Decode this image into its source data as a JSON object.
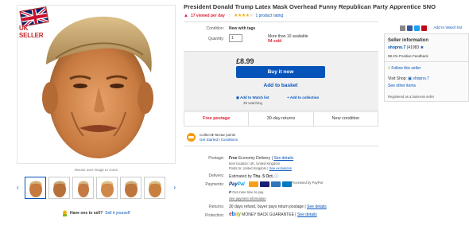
{
  "badge": {
    "text": "UK SELLER"
  },
  "gallery": {
    "hover_note": "Mouse over image to zoom",
    "prev_arrow": "‹",
    "next_arrow": "›",
    "thumb_count": 6
  },
  "sell": {
    "question": "Have one to sell?",
    "link": "Sell it yourself"
  },
  "listing": {
    "title": "President Donald Trump Latex Mask Overhead Funny Republican Party Apprentice SNO",
    "viewed": "17 viewed per day",
    "rating_link": "1 product rating",
    "rating_value": 4.5
  },
  "details": {
    "condition_label": "Condition:",
    "condition_value": "New with tags",
    "quantity_label": "Quantity:",
    "quantity_value": "1",
    "availability": "More than 10 available",
    "sold": "94 sold"
  },
  "buy": {
    "price": "£8.99",
    "buy_now": "Buy it now",
    "add_basket": "Add to basket",
    "watch_list": "Add to Watch list",
    "collection": "Add to collection",
    "watching": "39 watching"
  },
  "features": [
    "Free postage",
    "30-day returns",
    "New condition"
  ],
  "nectar": {
    "line1_prefix": "Collect ",
    "points": "9",
    "line1_suffix": " Nectar points",
    "get_started": "Get Started",
    "conditions": "Conditions"
  },
  "postage": {
    "label": "Postage:",
    "free": "Free",
    "service": "Economy Delivery",
    "see_details": "See details",
    "location": "Item location: UK, United Kingdom",
    "posts_to": "Posts to: United Kingdom",
    "see_exclusions": "See exclusions"
  },
  "delivery": {
    "label": "Delivery:",
    "prefix": "Estimated by ",
    "date": "Thu. 5 Oct."
  },
  "payments": {
    "label": "Payments:",
    "paypal_a": "Pay",
    "paypal_b": "Pal",
    "processed": "Processed by PayPal",
    "credit": "Get more time to pay.",
    "see_info": "See payment information"
  },
  "returns": {
    "label": "Returns:",
    "text": "30 days refund, buyer pays return postage",
    "see_details": "See details"
  },
  "protection": {
    "label": "Protection:",
    "e": "e",
    "b": "b",
    "a": "a",
    "y": "y",
    "guarantee": "MONEY BACK GUARANTEE",
    "see_details": "See details"
  },
  "share": {
    "add_watch": "Add to Watch list"
  },
  "seller": {
    "heading": "Seller information",
    "name": "shopno.7",
    "score": "(41983",
    "positive": "98.2% Positive Feedback",
    "follow": "Follow this seller",
    "visit_label": "Visit Shop:",
    "shop": "shopno.7",
    "other_items": "See other items",
    "business": "Registered as a business seller"
  },
  "colors": {
    "link": "#0654ba",
    "alert": "#dd1e31",
    "star": "#f5af02",
    "buy_button": "#0654ba"
  }
}
